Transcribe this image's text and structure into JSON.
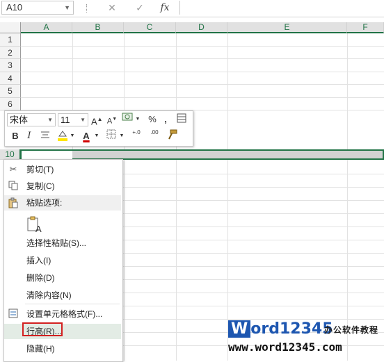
{
  "formula_bar": {
    "name_box": "A10",
    "cancel_icon": "✕",
    "enter_icon": "✓",
    "fx_label": "fx",
    "formula": ""
  },
  "columns": [
    "A",
    "B",
    "C",
    "D",
    "E",
    "F"
  ],
  "rows": [
    "1",
    "2",
    "3",
    "4",
    "5",
    "6",
    "10"
  ],
  "mini_toolbar": {
    "font_name": "宋体",
    "font_size": "11",
    "grow_font": "A",
    "shrink_font": "A",
    "percent": "%",
    "comma": ",",
    "bold": "B",
    "italic": "I",
    "font_color": "A",
    "inc_decimal": "+.0",
    "dec_decimal": ".00"
  },
  "context_menu": {
    "items": [
      {
        "label": "剪切(T)",
        "icon": "scissors-icon"
      },
      {
        "label": "复制(C)",
        "icon": "copy-icon"
      },
      {
        "label": "粘贴选项:",
        "icon": "paste-icon"
      },
      {
        "label": "选择性粘贴(S)...",
        "icon": ""
      },
      {
        "label": "插入(I)",
        "icon": ""
      },
      {
        "label": "删除(D)",
        "icon": ""
      },
      {
        "label": "清除内容(N)",
        "icon": ""
      },
      {
        "label": "设置单元格格式(F)...",
        "icon": "format-cells-icon"
      },
      {
        "label": "行高(R)...",
        "icon": ""
      },
      {
        "label": "隐藏(H)",
        "icon": ""
      }
    ]
  },
  "watermark": {
    "brand_prefix": "W",
    "brand_rest": "ord12345",
    "tagline": "办公软件教程",
    "url": "www.word12345.com"
  },
  "colors": {
    "excel_green": "#217346",
    "highlight_red": "#d32020"
  }
}
